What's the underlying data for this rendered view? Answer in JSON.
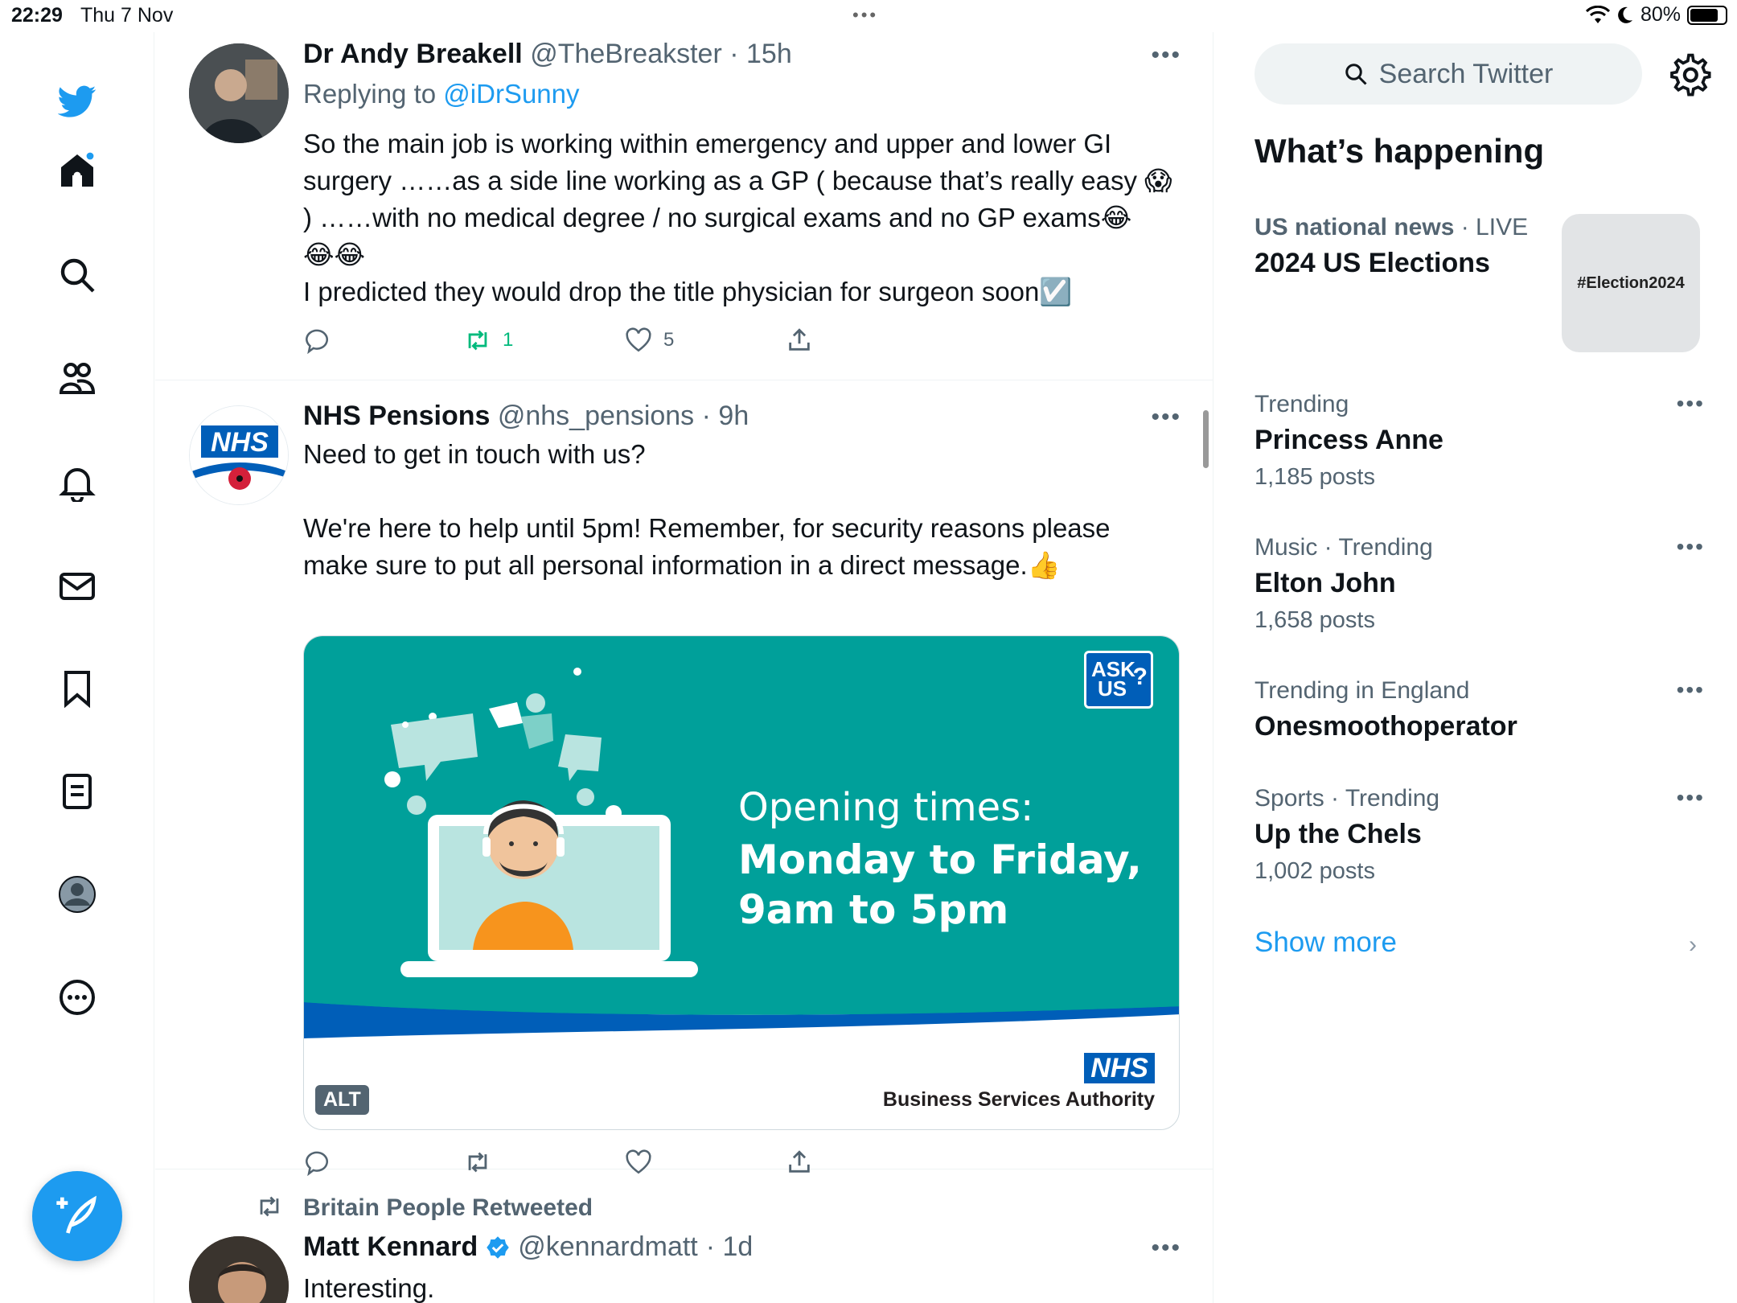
{
  "status_bar": {
    "time": "22:29",
    "date": "Thu 7 Nov",
    "battery": "80%",
    "battery_level": 0.8
  },
  "nav": {
    "items": [
      "twitter-logo",
      "home",
      "explore",
      "communities",
      "notifications",
      "messages",
      "bookmarks",
      "lists",
      "profile",
      "more"
    ]
  },
  "tweets": [
    {
      "name": "Dr Andy Breakell",
      "handle": "@TheBreakster",
      "time": "· 15h",
      "replying_label": "Replying to",
      "replying_to": "@iDrSunny",
      "text": "So the main job is working within emergency and upper and lower GI surgery ……as a side line working as a GP ( because that’s really easy 😱 ) ……with no medical degree / no surgical exams and no GP exams😂\n😂😂\nI predicted they would drop the title physician for surgeon soon☑️",
      "retweets": "1",
      "likes": "5"
    },
    {
      "name": "NHS Pensions",
      "handle": "@nhs_pensions",
      "time": "· 9h",
      "text": "Need to get in touch with us?\n\nWe're here to help until 5pm! Remember, for security reasons please make sure to put all personal information in a direct message.👍",
      "media": {
        "badge_top": "ASK",
        "badge_bottom": "US",
        "badge_q": "?",
        "line1": "Opening times:",
        "line2": "Monday to Friday,",
        "line3": "9am to 5pm",
        "alt": "ALT",
        "nhs": "NHS",
        "authority": "Business Services Authority"
      }
    },
    {
      "retweeted_by": "Britain People Retweeted",
      "name": "Matt Kennard",
      "handle": "@kennardmatt",
      "time": "· 1d",
      "text": "Interesting."
    }
  ],
  "sidebar": {
    "search_placeholder": "Search Twitter",
    "whats_happening": "What’s happening",
    "featured": {
      "category": "US national news",
      "live": "· LIVE",
      "topic": "2024 US Elections",
      "image_text": "#Election2024"
    },
    "trends": [
      {
        "meta": "Trending",
        "topic": "Princess Anne",
        "count": "1,185 posts"
      },
      {
        "meta": "Music · Trending",
        "topic": "Elton John",
        "count": "1,658 posts"
      },
      {
        "meta": "Trending in England",
        "topic": "Onesmoothoperator",
        "count": ""
      },
      {
        "meta": "Sports · Trending",
        "topic": "Up the Chels",
        "count": "1,002 posts"
      }
    ],
    "show_more": "Show more"
  },
  "colors": {
    "accent": "#1d9bf0",
    "retweet_green": "#00ba7c",
    "media_teal": "#00a09a",
    "nhs_blue": "#005eb8"
  }
}
